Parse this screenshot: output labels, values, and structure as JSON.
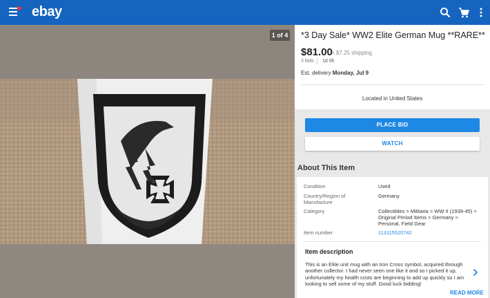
{
  "header": {
    "logo": "ebay",
    "icons": [
      "menu-icon",
      "search-icon",
      "cart-icon",
      "more-vert-icon"
    ]
  },
  "gallery": {
    "counter": "1 of 4"
  },
  "listing": {
    "title": "*3 Day Sale* WW2 Elite German Mug **RARE**",
    "price": "$81.00",
    "shipping": "+ $7.25 shipping",
    "bids": "3 bids",
    "time_left": "1d 0h",
    "delivery_prefix": "Est. delivery ",
    "delivery_date": "Monday, Jul 9",
    "location": "Located in United States"
  },
  "actions": {
    "place_bid": "PLACE BID",
    "watch": "WATCH"
  },
  "about": {
    "heading": "About This Item",
    "specs": [
      {
        "label": "Condition",
        "value": "Used"
      },
      {
        "label": "Country/Region of Manufacture",
        "value": "Germany"
      },
      {
        "label": "Category",
        "value": "Collectibles > Militaria > WW II (1939-45) > Original Period Items > Germany > Personal, Field Gear"
      },
      {
        "label": "Item number",
        "value": "113115520742"
      }
    ],
    "description_title": "Item description",
    "description": "This is an Elite unit mug with an Iron Cross symbol, acquired through another collector. I had never seen one like it and so I picked it up, unfortunately my health costs are beginning to add up quickly so I am looking to sell some of my stuff.  Good luck bidding!",
    "read_more": "READ MORE"
  },
  "colors": {
    "appbar": "#1565c0",
    "accent": "#1e88e5",
    "logo_dot": "#e53238"
  }
}
